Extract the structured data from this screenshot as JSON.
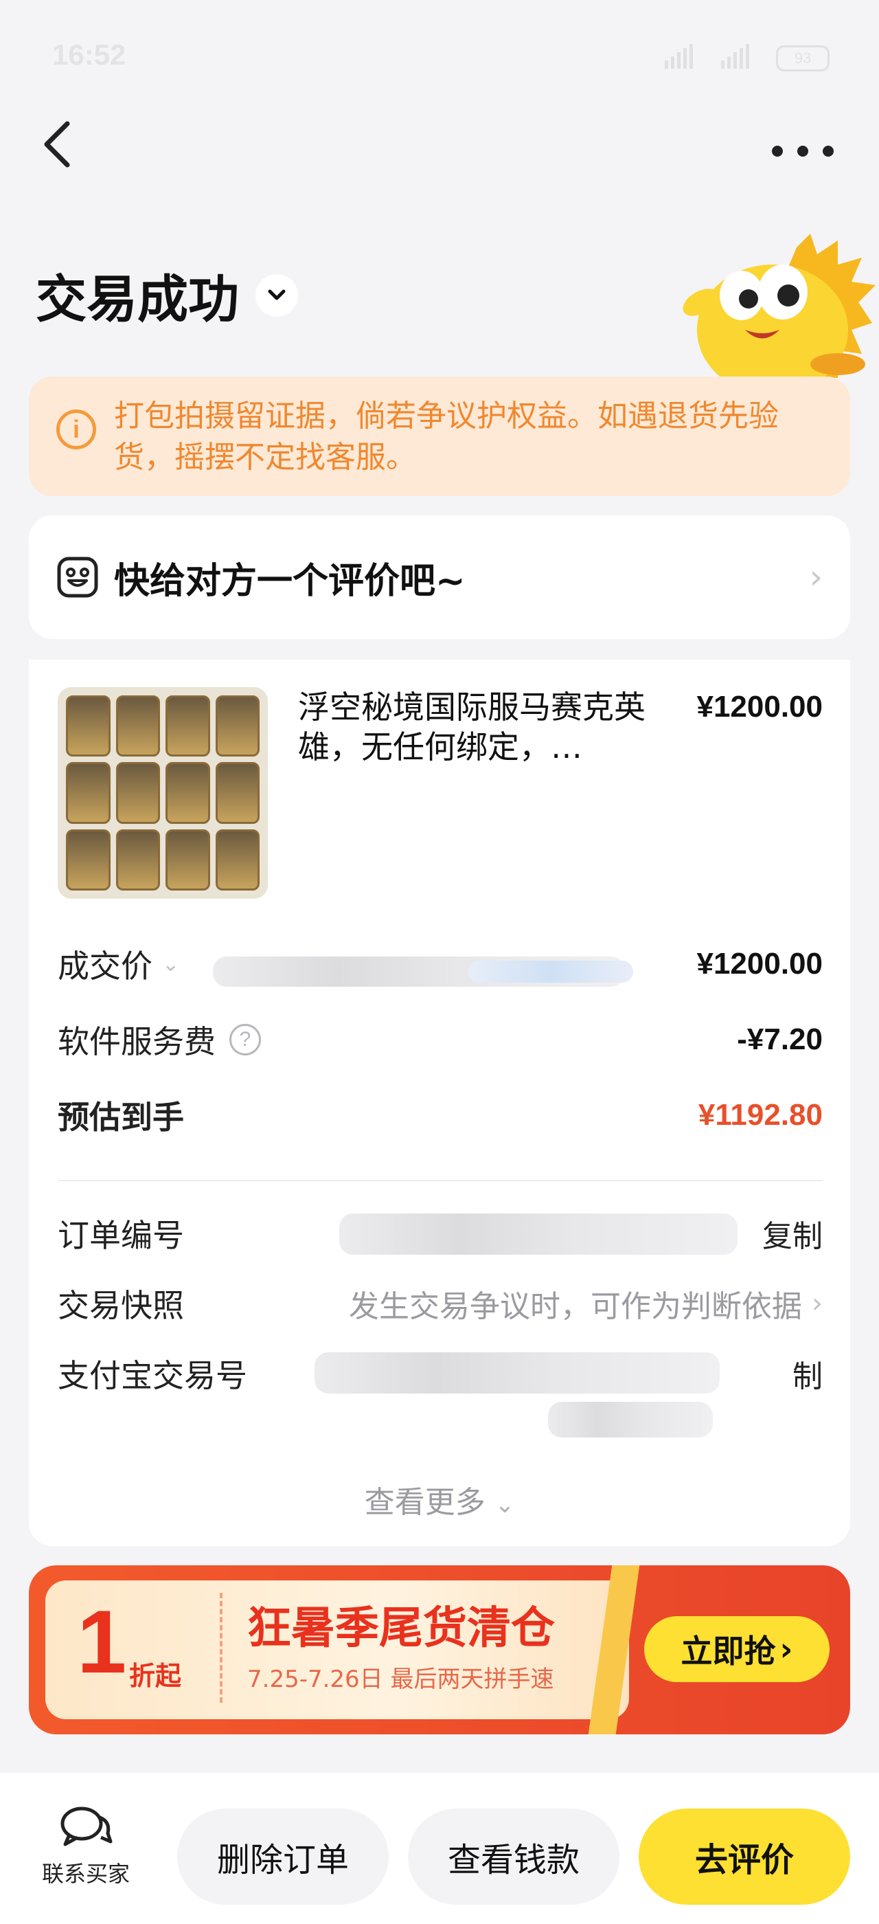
{
  "status_bar": {
    "time": "16:52",
    "battery": "93"
  },
  "header": {
    "title": "交易成功"
  },
  "notice": {
    "text": "打包拍摄留证据，倘若争议护权益。如遇退货先验货，摇摆不定找客服。"
  },
  "review": {
    "text": "快给对方一个评价吧~"
  },
  "product": {
    "title": "浮空秘境国际服马赛克英雄，无任何绑定，…",
    "price": "¥1200.00"
  },
  "price_rows": [
    {
      "label": "成交价",
      "value": "¥1200.00"
    },
    {
      "label": "软件服务费",
      "value": "-¥7.20"
    },
    {
      "label": "预估到手",
      "value": "¥1192.80"
    }
  ],
  "info_rows": [
    {
      "label": "订单编号",
      "action": "复制"
    },
    {
      "label": "交易快照",
      "action": "发生交易争议时，可作为判断依据"
    },
    {
      "label": "支付宝交易号",
      "action": "制"
    }
  ],
  "see_more": "查看更多",
  "banner": {
    "number": "1",
    "number_suffix": "折起",
    "title": "狂暑季尾货清仓",
    "subtitle": "7.25-7.26日 最后两天拼手速",
    "button": "立即抢"
  },
  "bottom": {
    "contact": "联系买家",
    "delete": "删除订单",
    "view_money": "查看钱款",
    "review": "去评价"
  },
  "colors": {
    "accent_yellow": "#fde032",
    "notice_orange": "#f0882e",
    "price_red": "#e8502a"
  }
}
